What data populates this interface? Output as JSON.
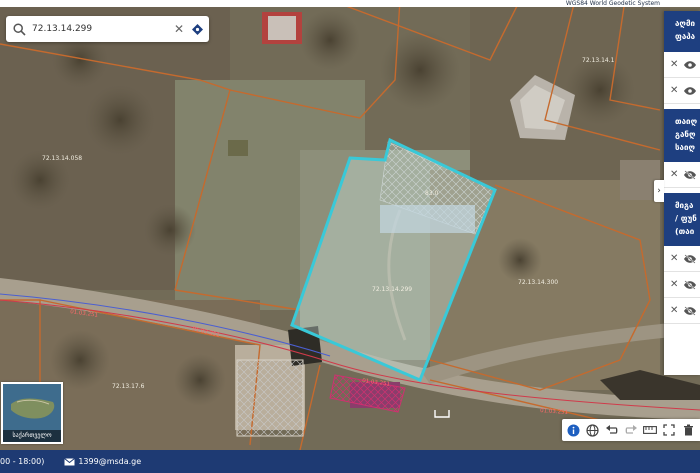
{
  "header": {
    "title": "WGS84 World Geodetic System"
  },
  "search": {
    "value": "72.13.14.299"
  },
  "panel": {
    "section1": [
      "აღმი",
      "ფაპა"
    ],
    "section2": [
      "თაიღ",
      "განღ",
      "საიღ"
    ],
    "section3": [
      "მიგა",
      "/ ფუნ",
      "(თაი"
    ]
  },
  "map": {
    "parcel_labels": {
      "main": "72.13.14.299",
      "top_left": "72.13.14.058",
      "top_right": "72.13.14.1",
      "right": "72.13.14.300",
      "bottom_left": "72.13.17.6",
      "hatched": "83.0"
    },
    "road_labels": [
      "01.03.251",
      "01.03.251",
      "01.03.251",
      "01.03.251"
    ]
  },
  "minimap": {
    "label": "საქართველო"
  },
  "status": {
    "hours": "00 - 18:00)",
    "email": "1399@msda.ge"
  },
  "colors": {
    "selection": "#39c9d8",
    "cadastre": "#c56a2e",
    "header": "#1e3f80",
    "status": "#1e3a73"
  }
}
